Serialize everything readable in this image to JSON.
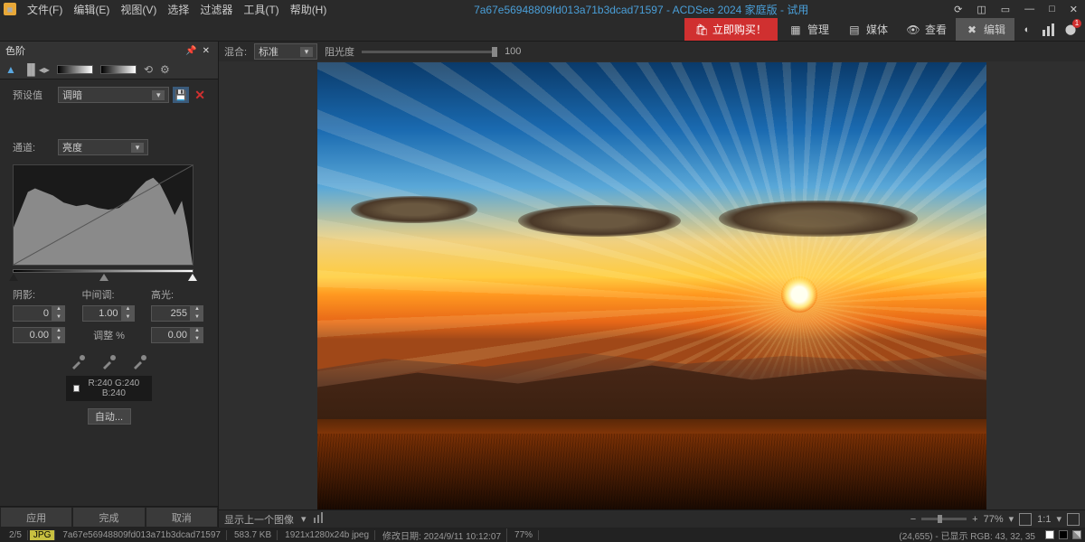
{
  "titlebar": {
    "menus": [
      "文件(F)",
      "编辑(E)",
      "视图(V)",
      "选择",
      "过滤器",
      "工具(T)",
      "帮助(H)"
    ],
    "title": "7a67e56948809fd013a71b3dcad71597 - ACDSee 2024 家庭版 - 试用"
  },
  "modebar": {
    "buy": "立即购买！",
    "modes": [
      {
        "label": "管理",
        "icon": "grid"
      },
      {
        "label": "媒体",
        "icon": "media"
      },
      {
        "label": "查看",
        "icon": "eye"
      },
      {
        "label": "编辑",
        "icon": "tools",
        "active": true
      }
    ]
  },
  "panel": {
    "title": "色阶",
    "preset_label": "预设值",
    "preset_value": "调暗",
    "channel_label": "通道:",
    "channel_value": "亮度",
    "shadows_label": "阴影:",
    "midtones_label": "中间调:",
    "highlights_label": "高光:",
    "shadows_val": "0",
    "midtones_val": "1.00",
    "highlights_val": "255",
    "shadows_out": "0.00",
    "adjust_pct_label": "调整 %",
    "highlights_out": "0.00",
    "rgb_readout": "R:240  G:240  B:240",
    "auto_btn": "自动...",
    "apply": "应用",
    "done": "完成",
    "cancel": "取消"
  },
  "workspace": {
    "blend_label": "混合:",
    "blend_value": "标准",
    "opacity_label": "阻光度",
    "opacity_value": "100",
    "prev_image": "显示上一个图像",
    "zoom_pct": "77%",
    "ratio": "1:1"
  },
  "statusbar": {
    "index": "2/5",
    "format": "JPG",
    "filename": "7a67e56948809fd013a71b3dcad71597",
    "size": "583.7 KB",
    "dimensions": "1921x1280x24b jpeg",
    "modified": "修改日期: 2024/9/11 10:12:07",
    "zoom": "77%",
    "coords": "(24,655) - 已显示 RGB: 43, 32, 35"
  }
}
